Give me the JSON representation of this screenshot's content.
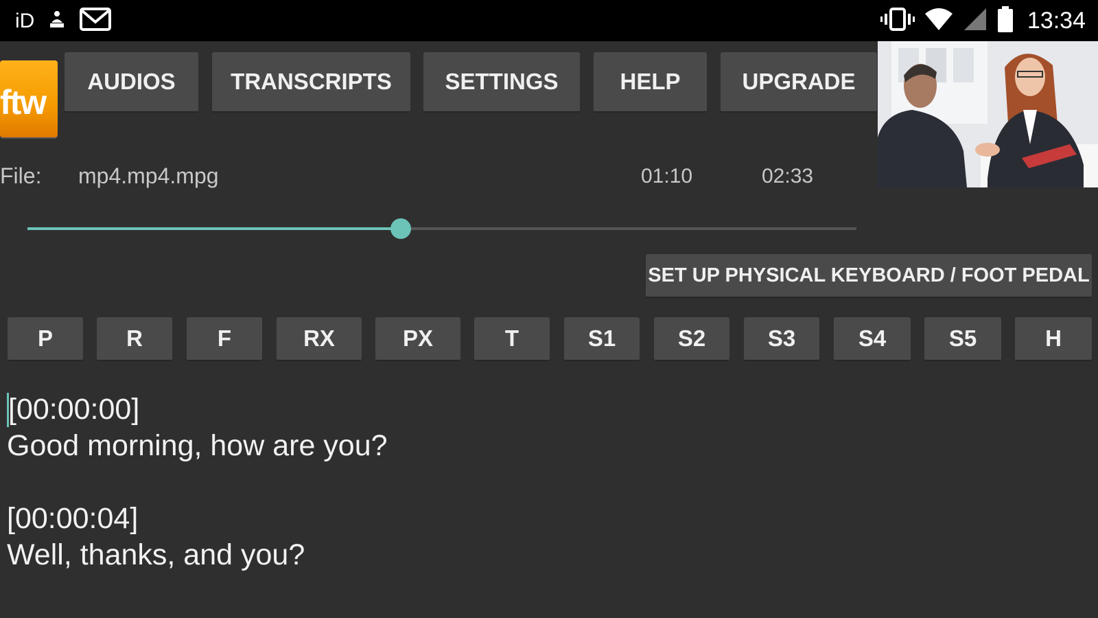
{
  "status_bar": {
    "left_text": "iD",
    "left_icons": [
      "person-upload-icon",
      "gmail-icon"
    ],
    "right_icons": [
      "vibrate-icon",
      "wifi-icon",
      "signal-icon",
      "battery-icon"
    ],
    "time": "13:34"
  },
  "logo": {
    "text": "ftw"
  },
  "nav": {
    "items": [
      {
        "label": "AUDIOS"
      },
      {
        "label": "TRANSCRIPTS"
      },
      {
        "label": "SETTINGS"
      },
      {
        "label": "HELP"
      },
      {
        "label": "UPGRADE"
      }
    ]
  },
  "player": {
    "file_label": "File:",
    "file_name": "mp4.mp4.mpg",
    "current_time": "01:10",
    "total_time": "02:33",
    "progress_fraction": 0.45,
    "accent_color": "#6cc3b8"
  },
  "setup_button": {
    "label": "SET UP PHYSICAL KEYBOARD / FOOT PEDAL"
  },
  "shortcut_keys": [
    "P",
    "R",
    "F",
    "RX",
    "PX",
    "T",
    "S1",
    "S2",
    "S3",
    "S4",
    "S5",
    "H"
  ],
  "transcript": {
    "lines": [
      "[00:00:00]",
      "Good morning, how are you?",
      "",
      "[00:00:04]",
      "Well, thanks, and you?"
    ]
  }
}
